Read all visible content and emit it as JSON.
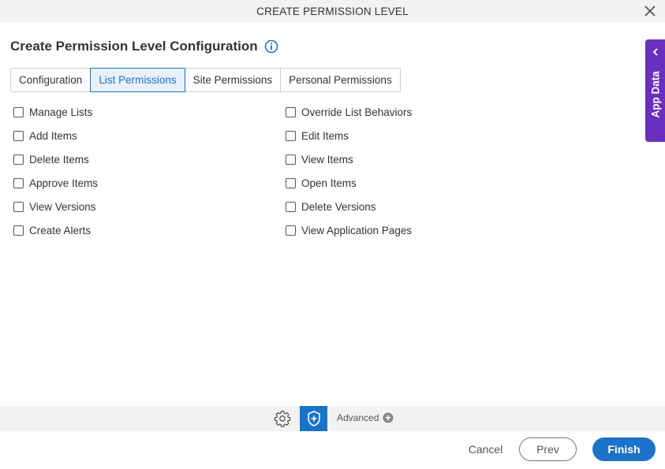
{
  "dialog": {
    "title": "CREATE PERMISSION LEVEL",
    "close_icon": "close-icon"
  },
  "header": {
    "title": "Create Permission Level Configuration",
    "info_icon": "info-icon"
  },
  "tabs": [
    {
      "label": "Configuration",
      "active": false
    },
    {
      "label": "List Permissions",
      "active": true
    },
    {
      "label": "Site Permissions",
      "active": false
    },
    {
      "label": "Personal Permissions",
      "active": false
    }
  ],
  "permissions": {
    "left": [
      {
        "label": "Manage Lists",
        "checked": false
      },
      {
        "label": "Add Items",
        "checked": false
      },
      {
        "label": "Delete Items",
        "checked": false
      },
      {
        "label": "Approve Items",
        "checked": false
      },
      {
        "label": "View Versions",
        "checked": false
      },
      {
        "label": "Create Alerts",
        "checked": false
      }
    ],
    "right": [
      {
        "label": "Override List Behaviors",
        "checked": false
      },
      {
        "label": "Edit Items",
        "checked": false
      },
      {
        "label": "View Items",
        "checked": false
      },
      {
        "label": "Open Items",
        "checked": false
      },
      {
        "label": "Delete Versions",
        "checked": false
      },
      {
        "label": "View Application Pages",
        "checked": false
      }
    ]
  },
  "side_panel": {
    "label": "App Data",
    "icon": "chevron-left-icon"
  },
  "toolbar": {
    "gear_icon": "gear-icon",
    "shield_icon": "shield-plus-icon",
    "advanced_label": "Advanced",
    "advanced_icon": "plus-circle-icon"
  },
  "footer": {
    "cancel_label": "Cancel",
    "prev_label": "Prev",
    "finish_label": "Finish"
  },
  "colors": {
    "accent": "#1a73c9",
    "side_panel": "#6b2fbf",
    "toolbar_bg": "#f2f2f2",
    "title_bg": "#f2f2f2"
  }
}
